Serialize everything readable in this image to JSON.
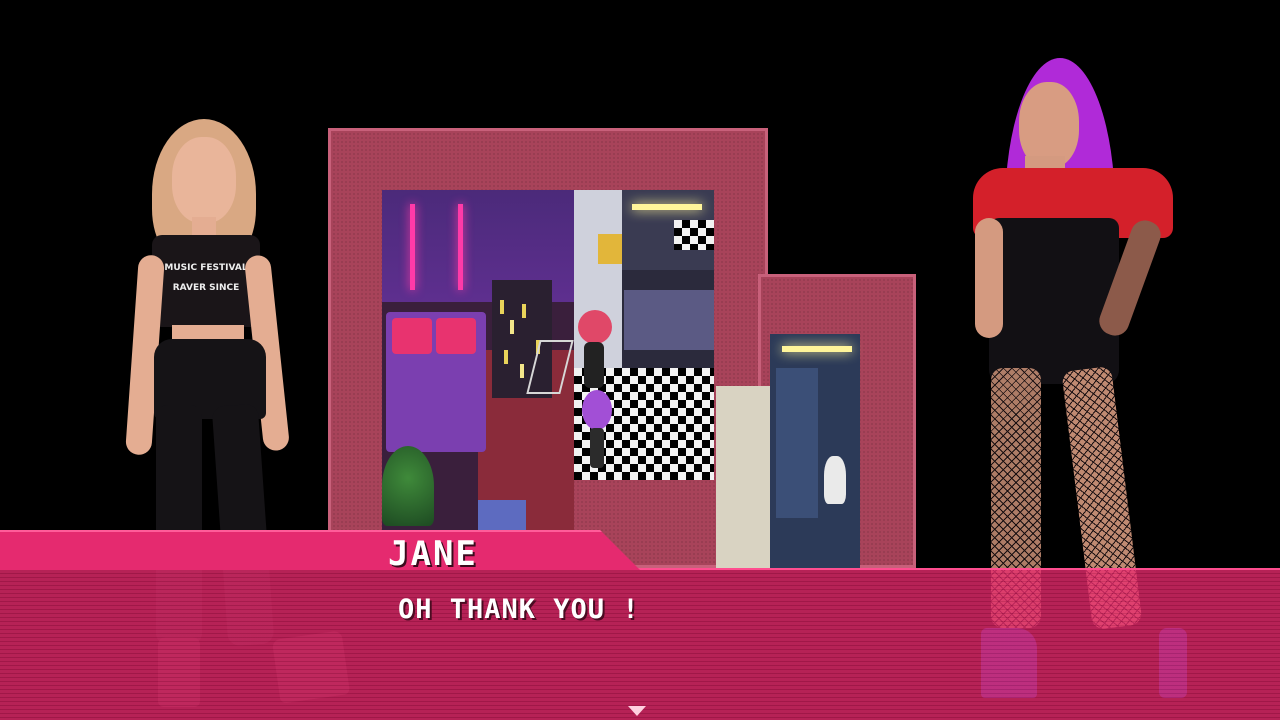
{
  "dialogue": {
    "speaker": "JANE",
    "line": "OH THANK YOU !",
    "advance_icon": "triangle-down-icon"
  },
  "characters": {
    "left": {
      "shirt_print": [
        "MUSIC FESTIVAL",
        "RAVER SINCE"
      ]
    },
    "right": {}
  },
  "colors": {
    "dialogue_pink": "#e52a6f",
    "neon": "#ff3aa8",
    "wall": "#a8435a"
  }
}
